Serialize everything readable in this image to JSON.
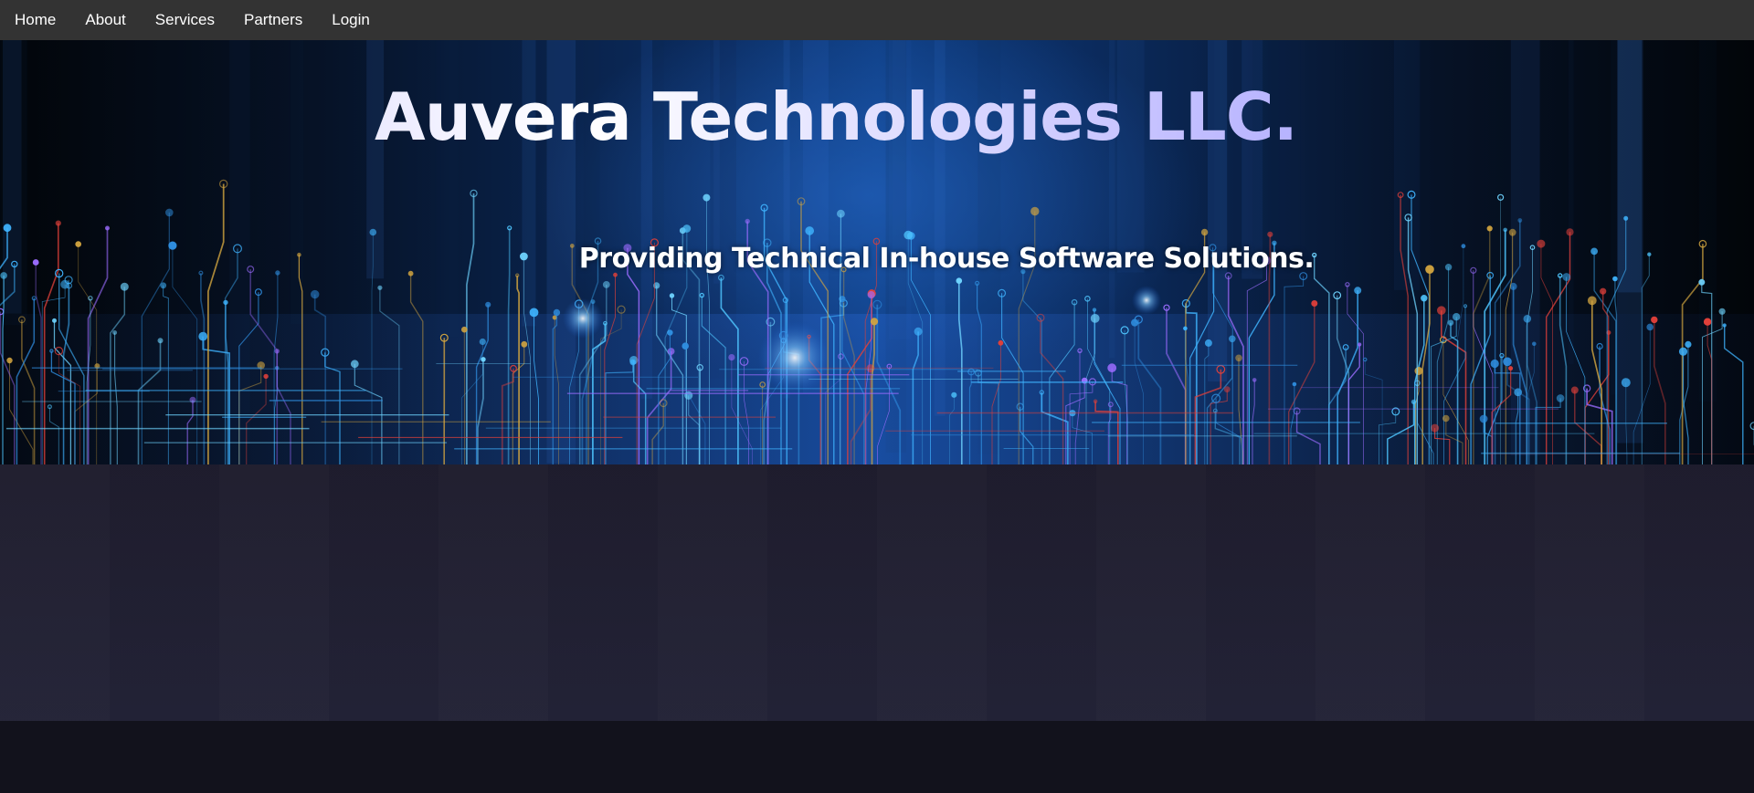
{
  "nav": {
    "items": [
      {
        "label": "Home"
      },
      {
        "label": "About"
      },
      {
        "label": "Services"
      },
      {
        "label": "Partners"
      },
      {
        "label": "Login"
      }
    ]
  },
  "hero": {
    "title": "Auvera Technologies LLC.",
    "subtitle": "Providing Technical In-house Software Solutions.",
    "background": "circuit-board-image"
  },
  "colors": {
    "navbar": "#333333",
    "hero_base": "#0b2b5e",
    "circuit": "#3fb4ff",
    "content": "#201f30",
    "footer": "#12121c"
  }
}
